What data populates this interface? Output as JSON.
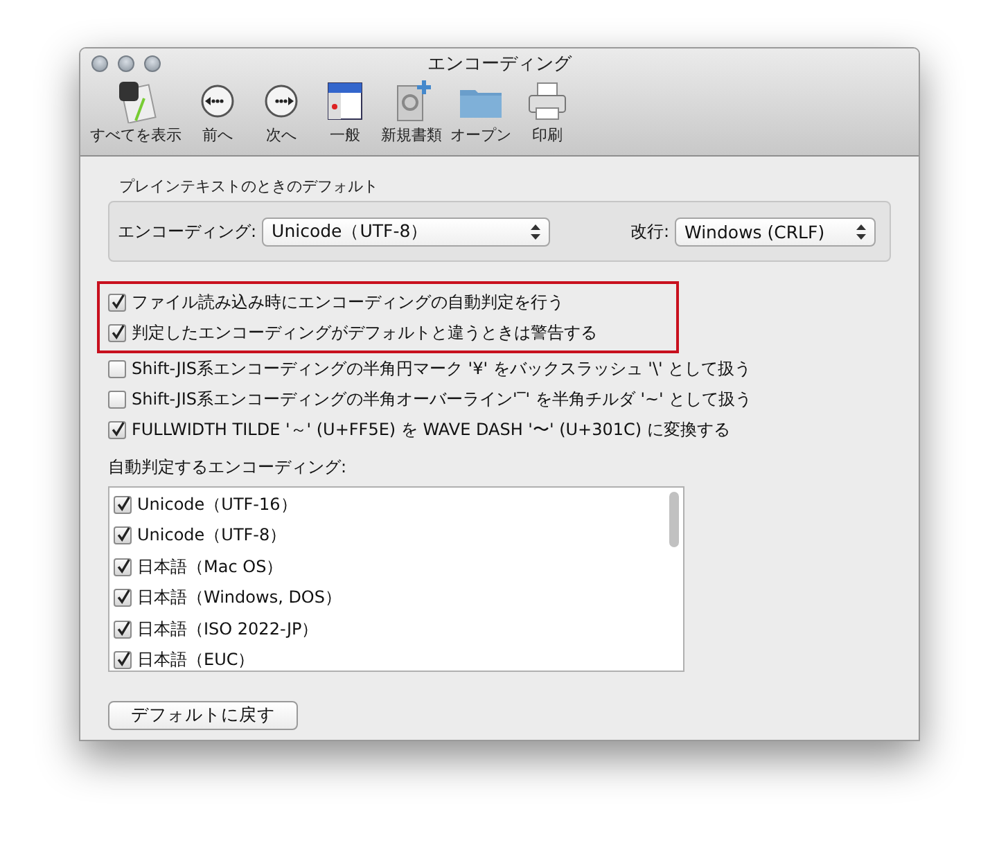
{
  "window": {
    "title": "エンコーディング"
  },
  "toolbar": [
    {
      "label": "すべてを表示",
      "kind": "showall"
    },
    {
      "label": "前へ",
      "kind": "back"
    },
    {
      "label": "次へ",
      "kind": "forward"
    },
    {
      "label": "一般",
      "kind": "general"
    },
    {
      "label": "新規書類",
      "kind": "newdoc"
    },
    {
      "label": "オープン",
      "kind": "open"
    },
    {
      "label": "印刷",
      "kind": "print"
    }
  ],
  "defaults": {
    "title": "プレインテキストのときのデフォルト",
    "encoding_label": "エンコーディング:",
    "encoding_value": "Unicode（UTF-8）",
    "newline_label": "改行:",
    "newline_value": "Windows (CRLF)"
  },
  "options": [
    {
      "label": "ファイル読み込み時にエンコーディングの自動判定を行う",
      "checked": true,
      "highlighted": true
    },
    {
      "label": "判定したエンコーディングがデフォルトと違うときは警告する",
      "checked": true,
      "highlighted": true
    },
    {
      "label": "Shift-JIS系エンコーディングの半角円マーク '¥' をバックスラッシュ '\\' として扱う",
      "checked": false,
      "highlighted": false
    },
    {
      "label": "Shift-JIS系エンコーディングの半角オーバーライン'‾' を半角チルダ '~' として扱う",
      "checked": false,
      "highlighted": false
    },
    {
      "label": "FULLWIDTH TILDE '～' (U+FF5E) を WAVE DASH '〜' (U+301C) に変換する",
      "checked": true,
      "highlighted": false
    }
  ],
  "auto_detect": {
    "label": "自動判定するエンコーディング:",
    "items": [
      {
        "label": "Unicode（UTF-16）",
        "checked": true
      },
      {
        "label": "Unicode（UTF-8）",
        "checked": true
      },
      {
        "label": "日本語（Mac OS）",
        "checked": true
      },
      {
        "label": "日本語（Windows, DOS）",
        "checked": true
      },
      {
        "label": "日本語（ISO 2022-JP）",
        "checked": true
      },
      {
        "label": "日本語（EUC）",
        "checked": true
      }
    ]
  },
  "reset_button": "デフォルトに戻す"
}
